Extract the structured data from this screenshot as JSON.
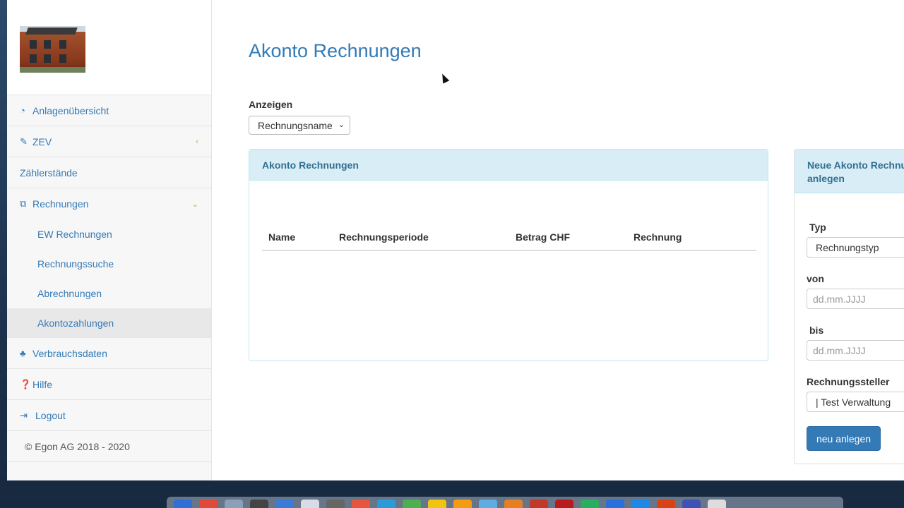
{
  "page": {
    "title": "Akonto Rechnungen"
  },
  "sidebar": {
    "items": [
      {
        "label": "Anlagenübersicht",
        "icon": "dashboard-icon"
      },
      {
        "label": "ZEV",
        "icon": "wrench-icon",
        "chevron": "chevron-left-icon"
      },
      {
        "label": "Zählerstände"
      },
      {
        "label": "Rechnungen",
        "icon": "copy-icon",
        "chevron": "chevron-down-icon",
        "subitems": [
          {
            "label": "EW Rechnungen"
          },
          {
            "label": "Rechnungssuche"
          },
          {
            "label": "Abrechnungen"
          },
          {
            "label": "Akontozahlungen",
            "active": true
          }
        ]
      },
      {
        "label": "Verbrauchsdaten",
        "icon": "sitemap-icon"
      },
      {
        "label": "Hilfe",
        "icon": "question-circle-icon"
      },
      {
        "label": "Logout",
        "icon": "sign-out-icon"
      }
    ],
    "copyright": "© Egon AG 2018 - 2020"
  },
  "filter": {
    "label": "Anzeigen",
    "selected": "Rechnungsname"
  },
  "table_panel": {
    "heading": "Akonto Rechnungen",
    "columns": [
      "Name",
      "Rechnungsperiode",
      "Betrag CHF",
      "Rechnung"
    ],
    "rows": []
  },
  "form_panel": {
    "heading_line1": "Neue Akonto Rechnu",
    "heading_line2": "anlegen",
    "type_label": "Typ",
    "type_value": "Rechnungstyp",
    "from_label": "von",
    "from_placeholder": "dd.mm.JJJJ",
    "to_label": "bis",
    "to_placeholder": "dd.mm.JJJJ",
    "issuer_label": "Rechnungssteller",
    "issuer_value": "| Test Verwaltung",
    "submit_label": "neu anlegen"
  },
  "colors": {
    "accent": "#337ab7",
    "panel_header": "#d9edf7",
    "panel_header_text": "#31708f",
    "chevron": "#c9a227"
  }
}
